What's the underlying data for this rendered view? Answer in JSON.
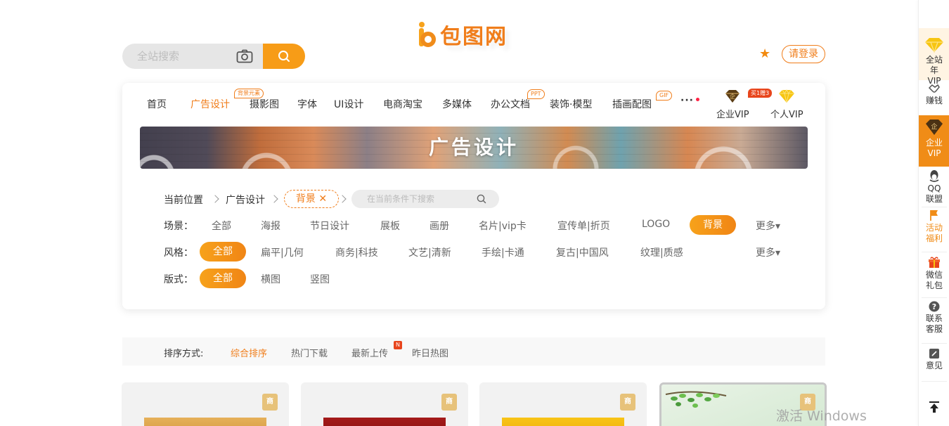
{
  "header": {
    "logo_text": "包图网",
    "search_placeholder": "全站搜索",
    "login_label": "请登录"
  },
  "nav": {
    "items": [
      {
        "label": "首页",
        "active": false
      },
      {
        "label": "广告设计",
        "active": true,
        "badge": "背景元素"
      },
      {
        "label": "摄影图",
        "active": false
      },
      {
        "label": "字体",
        "active": false
      },
      {
        "label": "UI设计",
        "active": false
      },
      {
        "label": "电商淘宝",
        "active": false
      },
      {
        "label": "多媒体",
        "active": false
      },
      {
        "label": "办公文档",
        "active": false,
        "badge": "PPT"
      },
      {
        "label": "装饰·模型",
        "active": false
      },
      {
        "label": "插画配图",
        "active": false,
        "badge": "GIF"
      }
    ],
    "more": "···",
    "enterprise_vip": "企业VIP",
    "enterprise_badge": "买1赠3",
    "personal_vip": "个人VIP"
  },
  "banner": {
    "title": "广告设计"
  },
  "breadcrumb": {
    "current_label": "当前位置",
    "level1": "广告设计",
    "tag": "背景",
    "search_placeholder": "在当前条件下搜索"
  },
  "filters": {
    "scene": {
      "label": "场景：",
      "options": [
        "全部",
        "海报",
        "节日设计",
        "展板",
        "画册",
        "名片|vip卡",
        "宣传单|折页",
        "LOGO",
        "背景"
      ],
      "selected": "背景",
      "more": "更多▾"
    },
    "style": {
      "label": "风格：",
      "options": [
        "全部",
        "扁平|几何",
        "商务|科技",
        "文艺|清新",
        "手绘|卡通",
        "复古|中国风",
        "纹理|质感"
      ],
      "selected": "全部",
      "more": "更多▾"
    },
    "layout": {
      "label": "版式：",
      "options": [
        "全部",
        "横图",
        "竖图"
      ],
      "selected": "全部"
    }
  },
  "sort": {
    "label": "排序方式:",
    "items": [
      "综合排序",
      "热门下载",
      "最新上传",
      "昨日热图"
    ],
    "active": "综合排序",
    "new_badge": "N"
  },
  "thumbnails": [
    {
      "badge": "商",
      "color": "#d9a34a"
    },
    {
      "badge": "商",
      "color": "#9e1616"
    },
    {
      "badge": "商",
      "color": "#f2b711"
    },
    {
      "badge": "商",
      "color": "#cfe6cf"
    }
  ],
  "sidebar": {
    "items": [
      {
        "label": "全站年VIP"
      },
      {
        "label": "赚钱"
      },
      {
        "label": "企业VIP"
      },
      {
        "label": "QQ联盟"
      },
      {
        "label": "活动福利"
      },
      {
        "label": "微信礼包"
      },
      {
        "label": "联系客服"
      },
      {
        "label": "意见"
      }
    ]
  },
  "watermark": "激活 Windows",
  "colors": {
    "accent": "#f07d1a",
    "accent_light": "#f7a21b"
  }
}
